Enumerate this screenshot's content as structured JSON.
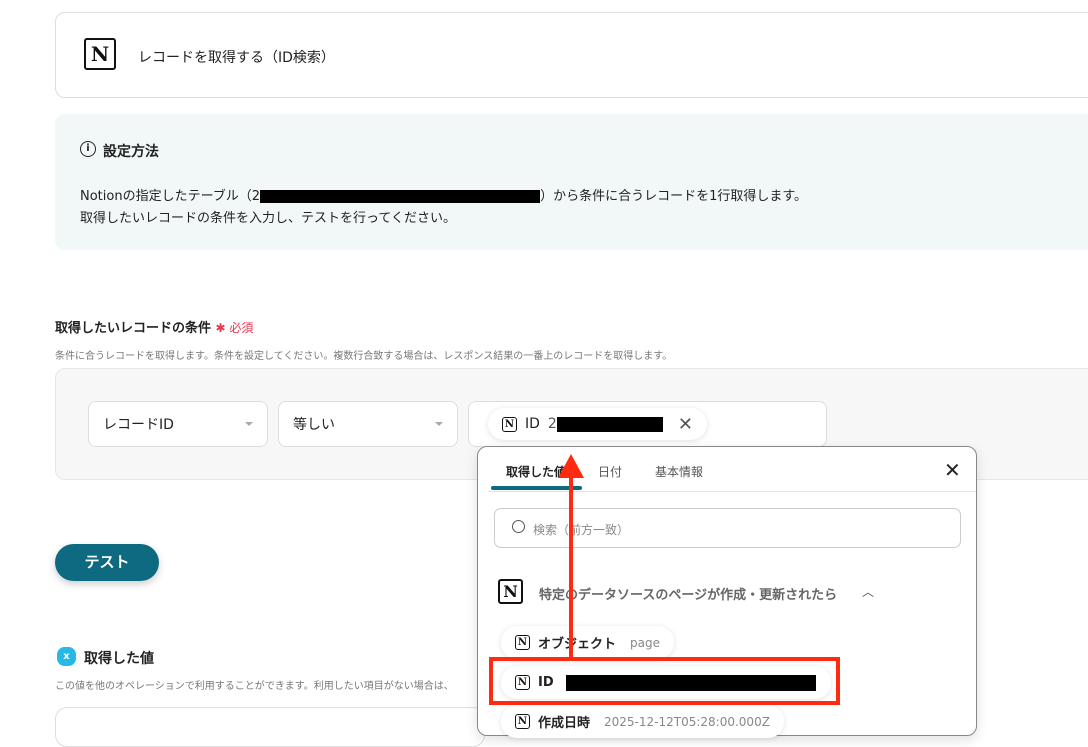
{
  "header": {
    "title": "レコードを取得する（ID検索）",
    "icon": "notion-logo-icon"
  },
  "info": {
    "heading": "設定方法",
    "line1_prefix": "Notionの指定したテーブル（2",
    "line1_suffix": "）から条件に合うレコードを1行取得します。",
    "line2": "取得したいレコードの条件を入力し、テストを行ってください。"
  },
  "condition": {
    "label": "取得したいレコードの条件",
    "required": "必須",
    "help": "条件に合うレコードを取得します。条件を設定してください。複数行合致する場合は、レスポンス結果の一番上のレコードを取得します。",
    "field": "レコードID",
    "operator": "等しい",
    "value_chip": {
      "label": "ID",
      "value_prefix": "2"
    }
  },
  "test_button": "テスト",
  "output": {
    "title": "取得した値",
    "help": "この値を他のオペレーションで利用することができます。利用したい項目がない場合は、"
  },
  "popup": {
    "tabs": [
      "取得した値",
      "日付",
      "基本情報"
    ],
    "active_tab": 0,
    "search_placeholder": "検索（前方一致）",
    "group": "特定のデータソースのページが作成・更新されたら",
    "items": [
      {
        "label": "オブジェクト",
        "value": "page"
      },
      {
        "label": "ID",
        "value": ""
      },
      {
        "label": "作成日時",
        "value": "2025-12-12T05:28:00.000Z"
      }
    ]
  },
  "colors": {
    "accent": "#0e6a80",
    "annotation": "#ff2a10",
    "required": "#e8384f"
  }
}
